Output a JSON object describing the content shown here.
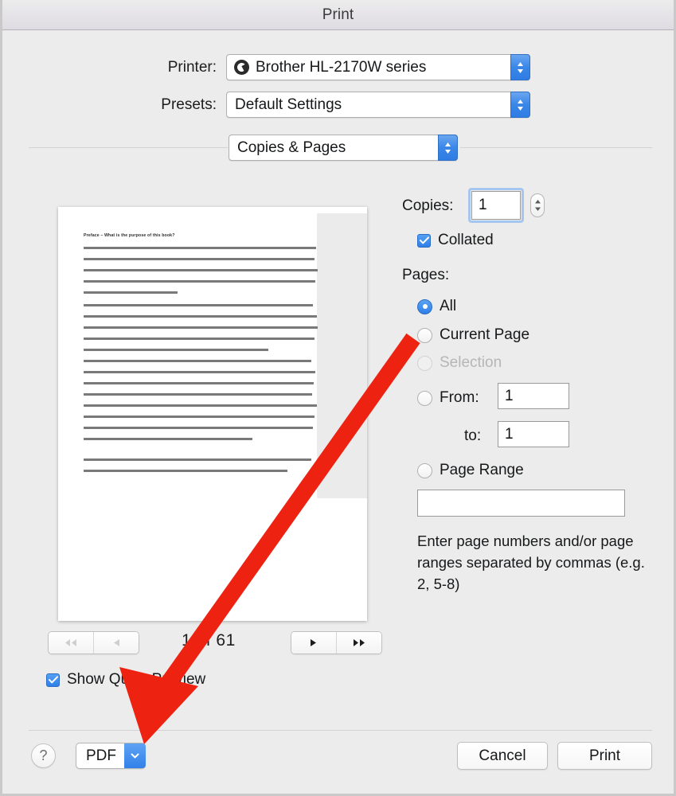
{
  "window": {
    "title": "Print"
  },
  "printer_row": {
    "label": "Printer:",
    "value": "Brother HL-2170W series",
    "icon": "printer-status-badge-icon"
  },
  "presets_row": {
    "label": "Presets:",
    "value": "Default Settings"
  },
  "pane_row": {
    "value": "Copies & Pages"
  },
  "preview": {
    "doc_heading": "Preface – What is the purpose of this book?",
    "page_current": "1",
    "page_separator": "of",
    "page_total": "61",
    "first_button": "first-page",
    "prev_button": "previous-page",
    "next_button": "next-page",
    "last_button": "last-page",
    "quick_preview_label": "Show Quick Preview",
    "quick_preview_checked": true
  },
  "options": {
    "copies_label": "Copies:",
    "copies_value": "1",
    "collated_label": "Collated",
    "collated_checked": true,
    "pages_label": "Pages:",
    "radios": [
      {
        "label": "All",
        "checked": true,
        "disabled": false
      },
      {
        "label": "Current Page",
        "checked": false,
        "disabled": false
      },
      {
        "label": "Selection",
        "checked": false,
        "disabled": true
      },
      {
        "label": "From:",
        "checked": false,
        "disabled": false
      },
      {
        "label": "Page Range",
        "checked": false,
        "disabled": false
      }
    ],
    "from_value": "1",
    "to_label": "to:",
    "to_value": "1",
    "page_range_value": "",
    "help_text": "Enter page numbers and/or page ranges separated by commas (e.g. 2, 5-8)"
  },
  "footer": {
    "help_label": "?",
    "pdf_label": "PDF",
    "cancel_label": "Cancel",
    "print_label": "Print"
  },
  "annotation": {
    "color": "#ee2211",
    "shape": "arrow-pointing-down-left-to-pdf-button"
  }
}
